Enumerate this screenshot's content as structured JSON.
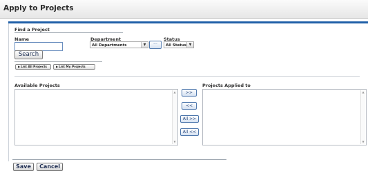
{
  "page": {
    "title": "Apply to Projects"
  },
  "find": {
    "heading": "Find a Project",
    "name_label": "Name",
    "name_value": "",
    "department_label": "Department",
    "department_value": "All Departments",
    "lookup_label": "...",
    "status_label": "Status",
    "status_value": "All Status",
    "search_label": "Search",
    "list_all_label": "List All Projects",
    "list_my_label": "List My Projects"
  },
  "lists": {
    "available_label": "Available Projects",
    "applied_label": "Projects Applied to",
    "available_items": [],
    "applied_items": []
  },
  "move": {
    "add": ">>",
    "remove": "<<",
    "add_all": "All >>",
    "remove_all": "All <<"
  },
  "footer": {
    "save": "Save",
    "cancel": "Cancel"
  },
  "icons": {
    "dropdown": "chevron-down-icon",
    "play": "play-triangle-icon",
    "scroll_up": "arrow-up-icon",
    "scroll_down": "arrow-down-icon"
  },
  "colors": {
    "accent": "#1f5fa8",
    "input_border": "#6b8fbf"
  }
}
